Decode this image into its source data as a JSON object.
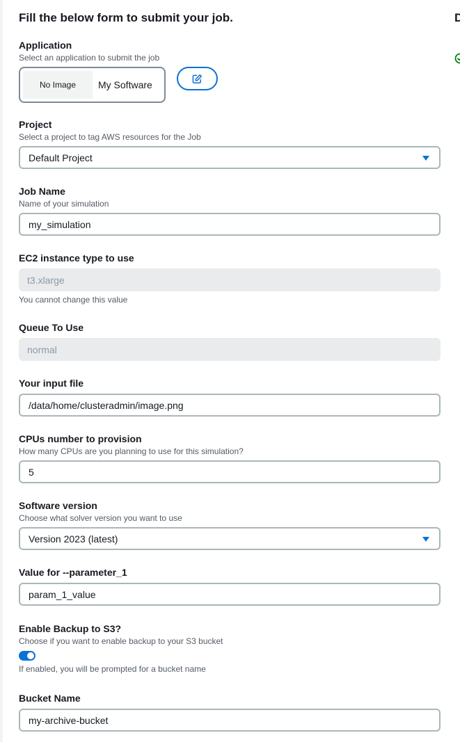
{
  "form": {
    "title": "Fill the below form to submit your job.",
    "application": {
      "label": "Application",
      "description": "Select an application to submit the job",
      "card_image_text": "No Image",
      "card_name": "My Software"
    },
    "project": {
      "label": "Project",
      "description": "Select a project to tag AWS resources for the Job",
      "value": "Default Project"
    },
    "job_name": {
      "label": "Job Name",
      "description": "Name of your simulation",
      "value": "my_simulation"
    },
    "instance_type": {
      "label": "EC2 instance type to use",
      "value": "t3.xlarge",
      "hint": "You cannot change this value"
    },
    "queue": {
      "label": "Queue To Use",
      "value": "normal"
    },
    "input_file": {
      "label": "Your input file",
      "value": "/data/home/clusteradmin/image.png"
    },
    "cpus": {
      "label": "CPUs number to provision",
      "description": "How many CPUs are you planning to use for this simulation?",
      "value": "5"
    },
    "software_version": {
      "label": "Software version",
      "description": "Choose what solver version you want to use",
      "value": "Version 2023 (latest)"
    },
    "parameter_1": {
      "label": "Value for --parameter_1",
      "value": "param_1_value"
    },
    "backup": {
      "label": "Enable Backup to S3?",
      "description": "Choose if you want to enable backup to your S3 bucket",
      "enabled": true,
      "hint": "If enabled, you will be prompted for a bucket name"
    },
    "bucket": {
      "label": "Bucket Name",
      "value": "my-archive-bucket"
    }
  },
  "side_panel": {
    "heading_fragment": "D"
  },
  "colors": {
    "accent": "#0972d3",
    "success": "#037f0c",
    "disabled_bg": "#e9ebed"
  },
  "icons": {
    "edit": "edit-icon",
    "caret": "caret-down-icon",
    "status": "check-circle-icon"
  }
}
